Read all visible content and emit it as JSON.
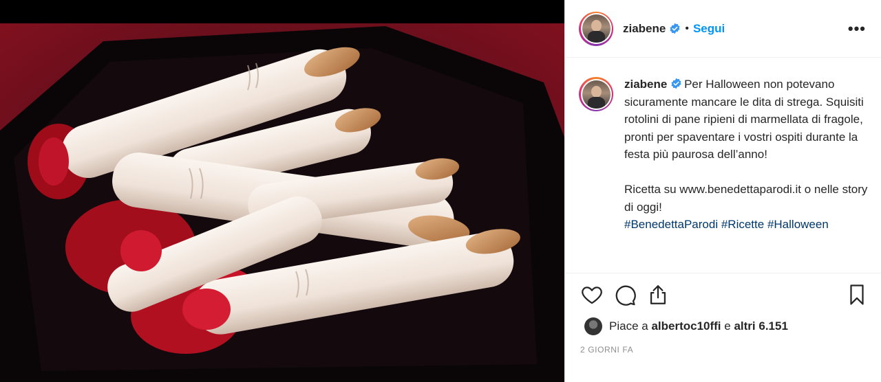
{
  "post": {
    "username": "ziabene",
    "follow_label": "Segui",
    "separator": "•",
    "more_label": "•••",
    "caption_username": "ziabene",
    "caption_text": " Per Halloween non potevano sicuramente mancare le dita di strega. Squisiti rotolini di pane ripieni di marmellata di fragole, pronti per spaventare i vostri ospiti durante la festa più paurosa dell’anno!\n\nRicetta su www.benedettaparodi.it o nelle story di oggi!\n",
    "hashtags": [
      "#BenedettaParodi",
      "#Ricette",
      "#Halloween"
    ],
    "likes_prefix": "Piace a",
    "likes_user": "albertoc10ffi",
    "likes_middle": "e",
    "likes_count": "altri 6.151",
    "timestamp": "2 GIORNI FA"
  },
  "icons": {
    "verified": "verified-badge-icon",
    "like": "heart-icon",
    "comment": "comment-icon",
    "share": "share-icon",
    "save": "bookmark-icon"
  },
  "colors": {
    "link": "#0095f6",
    "hashtag": "#00376b",
    "verified": "#3897f0",
    "muted": "#8e8e8e"
  }
}
